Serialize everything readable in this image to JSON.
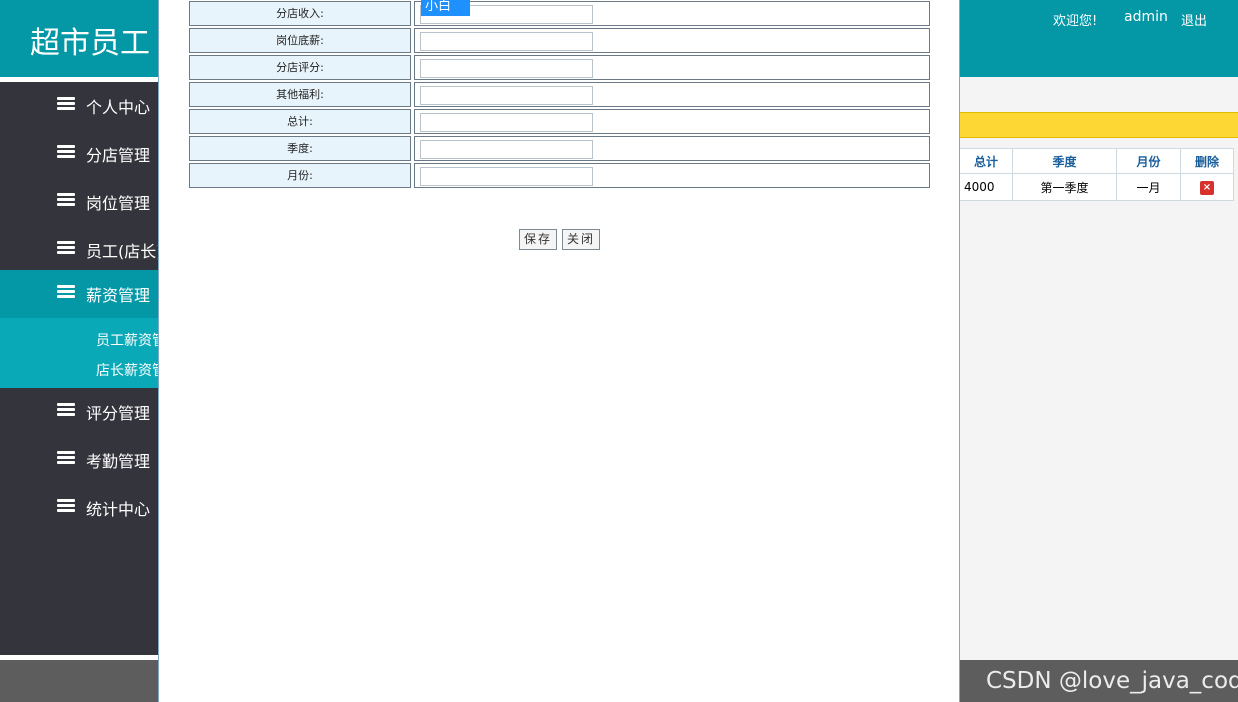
{
  "header": {
    "title": "超市员工",
    "welcome": "欢迎您!",
    "user": "admin",
    "logout": "退出"
  },
  "sidebar": {
    "items": [
      {
        "label": "个人中心",
        "icon": "stack-icon"
      },
      {
        "label": "分店管理",
        "icon": "stack-icon"
      },
      {
        "label": "岗位管理",
        "icon": "stack-icon"
      },
      {
        "label": "员工(店长)",
        "icon": "stack-icon"
      },
      {
        "label": "薪资管理",
        "icon": "stack-icon"
      },
      {
        "label": "评分管理",
        "icon": "stack-icon"
      },
      {
        "label": "考勤管理",
        "icon": "stack-icon"
      },
      {
        "label": "统计中心",
        "icon": "stack-icon"
      }
    ],
    "submenu": [
      "员工薪资管",
      "店长薪资管"
    ]
  },
  "background_table": {
    "headers": [
      "总计",
      "季度",
      "月份",
      "删除"
    ],
    "rows": [
      [
        "4000",
        "第一季度",
        "一月",
        "×"
      ]
    ]
  },
  "dialog": {
    "dropdown_selected": "小白",
    "fields": [
      {
        "label": "分店收入:",
        "value": ""
      },
      {
        "label": "岗位底薪:",
        "value": ""
      },
      {
        "label": "分店评分:",
        "value": ""
      },
      {
        "label": "其他福利:",
        "value": ""
      },
      {
        "label": "总计:",
        "value": ""
      },
      {
        "label": "季度:",
        "value": ""
      },
      {
        "label": "月份:",
        "value": ""
      }
    ],
    "save_label": "保存",
    "close_label": "关闭"
  },
  "watermark": "CSDN @love_java_code",
  "colors": {
    "accent": "#0497a6",
    "sidebar": "#34343c",
    "highlight": "#fdd835"
  }
}
